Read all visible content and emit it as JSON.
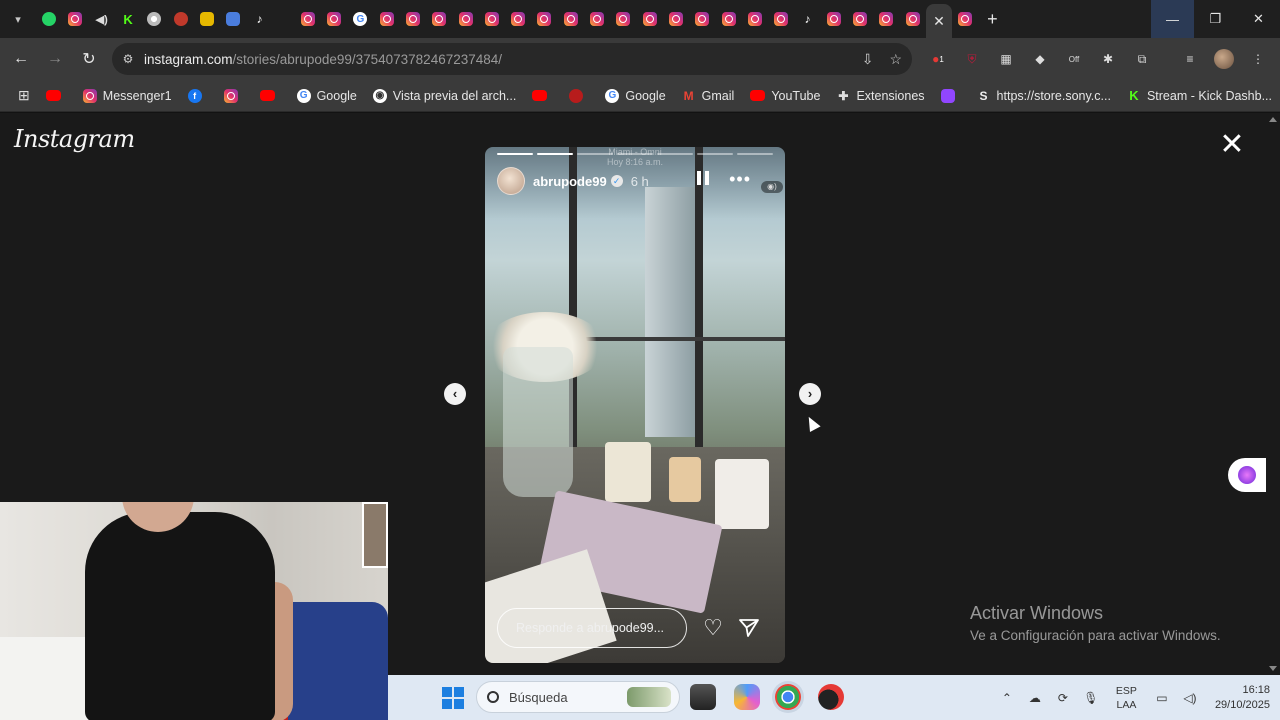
{
  "browser": {
    "active_tab_close": "✕",
    "new_tab": "+",
    "url_host": "instagram.com",
    "url_path": "/stories/abrupode99/3754073782467237484/",
    "extension_badge": "1",
    "extension_off_label": "Off"
  },
  "bookmarks": [
    {
      "icon": "youtube-icon",
      "label": ""
    },
    {
      "icon": "instagram-icon",
      "label": "Messenger1"
    },
    {
      "icon": "facebook-icon",
      "label": ""
    },
    {
      "icon": "instagram-icon",
      "label": ""
    },
    {
      "icon": "youtube-icon",
      "label": ""
    },
    {
      "icon": "google-icon",
      "label": "Google"
    },
    {
      "icon": "archive-icon",
      "label": "Vista previa del arch..."
    },
    {
      "icon": "youtube-icon",
      "label": ""
    },
    {
      "icon": "shield-icon",
      "label": ""
    },
    {
      "icon": "google-icon",
      "label": "Google"
    },
    {
      "icon": "gmail-icon",
      "label": "Gmail"
    },
    {
      "icon": "youtube-icon",
      "label": "YouTube"
    },
    {
      "icon": "puzzle-icon",
      "label": "Extensiones"
    },
    {
      "icon": "twitch-icon",
      "label": ""
    },
    {
      "icon": "sony-icon",
      "label": "https://store.sony.c..."
    },
    {
      "icon": "kick-icon",
      "label": "Stream - Kick Dashb..."
    }
  ],
  "page": {
    "logo_text": "Instagram",
    "close_symbol": "✕"
  },
  "story": {
    "ghost_title": "Miami - Omni",
    "ghost_subtitle": "Hoy 8:16 a.m.",
    "username": "abrupode99",
    "verified_mark": "✓",
    "time_ago": "6 h",
    "more_symbol": "•••",
    "reply_placeholder": "Responde a abrupode99...",
    "heart_symbol": "♡",
    "progress_segments": 7,
    "progress_done": 2
  },
  "navigation": {
    "prev_symbol": "‹",
    "next_symbol": "›"
  },
  "windows_watermark": {
    "title": "Activar Windows",
    "subtitle": "Ve a Configuración para activar Windows."
  },
  "taskbar": {
    "search_placeholder": "Búsqueda",
    "lang_top": "ESP",
    "lang_bottom": "LAA",
    "time": "16:18",
    "date": "29/10/2025"
  },
  "colors": {
    "instagram_gradient": "#e1306c",
    "verified_blue": "#3897f0",
    "windows_blue": "#1d7fe0"
  }
}
